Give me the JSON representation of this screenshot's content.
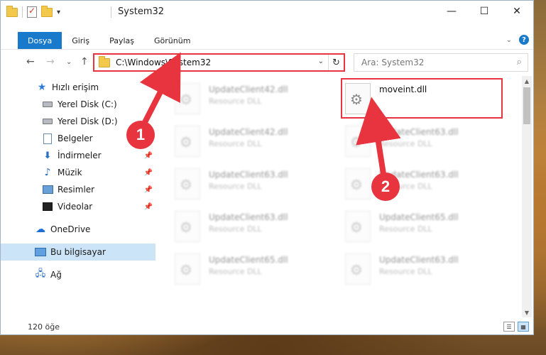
{
  "titlebar": {
    "title": "System32",
    "controls": {
      "minimize": "—",
      "maximize": "☐",
      "close": "✕"
    }
  },
  "ribbon": {
    "tabs": [
      {
        "label": "Dosya"
      },
      {
        "label": "Giriş"
      },
      {
        "label": "Paylaş"
      },
      {
        "label": "Görünüm"
      }
    ]
  },
  "navbar": {
    "back": "←",
    "forward": "→",
    "recent": "⌄",
    "up": "↑",
    "address": "C:\\Windows\\System32",
    "refresh": "↻",
    "search_placeholder": "Ara: System32",
    "search_icon": "⌕"
  },
  "sidebar": {
    "items": [
      {
        "label": "Hızlı erişim",
        "icon": "star-icon"
      },
      {
        "label": "Yerel Disk (C:)",
        "icon": "drive-icon"
      },
      {
        "label": "Yerel Disk (D:)",
        "icon": "drive-icon"
      },
      {
        "label": "Belgeler",
        "icon": "document-icon"
      },
      {
        "label": "İndirmeler",
        "icon": "download-icon"
      },
      {
        "label": "Müzik",
        "icon": "music-icon"
      },
      {
        "label": "Resimler",
        "icon": "picture-icon"
      },
      {
        "label": "Videolar",
        "icon": "video-icon"
      },
      {
        "label": "OneDrive",
        "icon": "cloud-icon"
      },
      {
        "label": "Bu bilgisayar",
        "icon": "computer-icon"
      },
      {
        "label": "Ağ",
        "icon": "network-icon"
      }
    ]
  },
  "files": [
    {
      "name": "UpdateClient42.dll",
      "type": "Resource DLL"
    },
    {
      "name": "moveint.dll",
      "type": ""
    },
    {
      "name": "UpdateClient42.dll",
      "type": "Resource DLL"
    },
    {
      "name": "UpdateClient63.dll",
      "type": "Resource DLL"
    },
    {
      "name": "UpdateClient63.dll",
      "type": "Resource DLL"
    },
    {
      "name": "UpdateClient63.dll",
      "type": "Resource DLL"
    },
    {
      "name": "UpdateClient63.dll",
      "type": "Resource DLL"
    },
    {
      "name": "UpdateClient65.dll",
      "type": "Resource DLL"
    },
    {
      "name": "UpdateClient65.dll",
      "type": "Resource DLL"
    },
    {
      "name": "UpdateClient63.dll",
      "type": "Resource DLL"
    }
  ],
  "status": {
    "count": "120 öğe"
  },
  "callouts": {
    "one": "1",
    "two": "2"
  },
  "colors": {
    "accent": "#1979ca",
    "highlight": "#e8343f",
    "selected": "#cce4f7"
  }
}
